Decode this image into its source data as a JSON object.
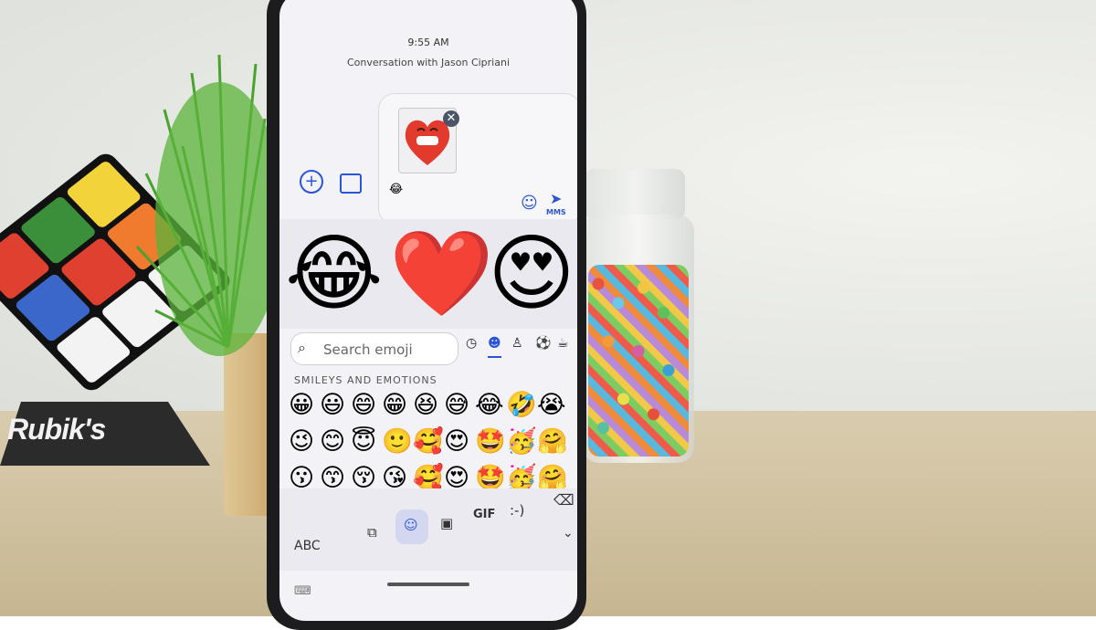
{
  "status": {
    "time": "9:55 AM"
  },
  "conversation": {
    "title": "Conversation with Jason Cipriani"
  },
  "compose": {
    "attachment_icon": "heart-grin-emoji",
    "remove_glyph": "✕",
    "small_emoji": "😂",
    "send_label": "MMS"
  },
  "suggestions": [
    "😂",
    "❤️",
    "😍"
  ],
  "search": {
    "placeholder": "Search emoji"
  },
  "categories": [
    "clock-icon",
    "smiley-icon",
    "person-icon",
    "activity-icon",
    "objects-icon"
  ],
  "section_title": "SMILEYS AND EMOTIONS",
  "emoji_grid": [
    "😀",
    "😃",
    "😄",
    "😁",
    "😆",
    "😅",
    "😂",
    "🤣",
    "😭",
    "😉",
    "😊",
    "😇",
    "🙂",
    "🥰",
    "😍",
    "🤩",
    "🥳",
    "🤗",
    "😗",
    "😙",
    "😚",
    "😘",
    "🥰",
    "😍",
    "🤩",
    "🥳",
    "🤗",
    "🙃",
    "☺️",
    "😌",
    "😊",
    "😏",
    "😐",
    "😑",
    "🤭",
    "🙂"
  ],
  "toolbar": {
    "abc": "ABC",
    "gif": "GIF",
    "emoticon": ":-)"
  }
}
